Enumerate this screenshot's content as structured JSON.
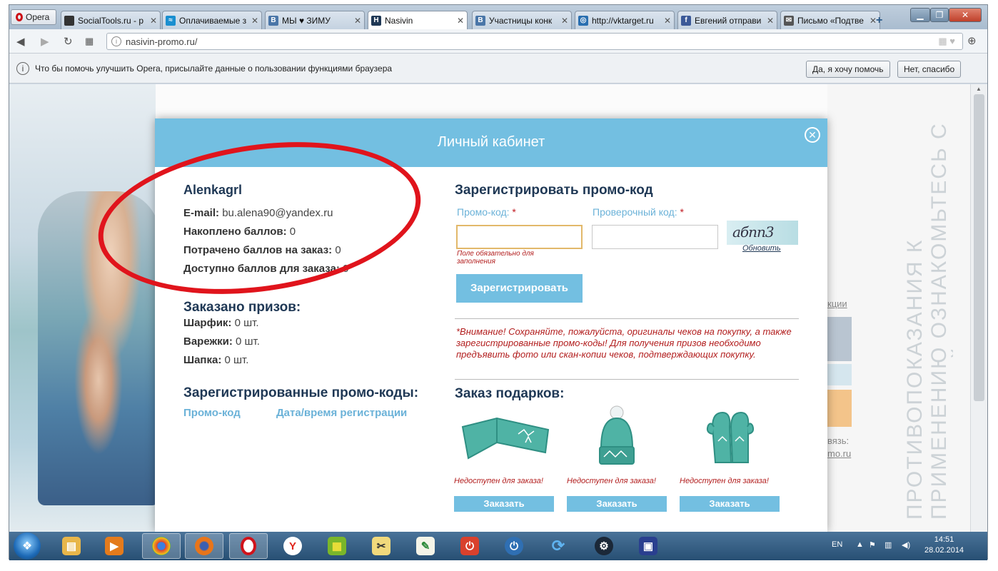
{
  "browser": {
    "menu_label": "Opera",
    "tabs": [
      {
        "title": "SocialTools.ru - р",
        "icon": "socialtools-icon",
        "color": "#333333",
        "glyph": ""
      },
      {
        "title": "Оплачиваемые з",
        "icon": "wave-icon",
        "color": "#1a8fd0",
        "glyph": "≈"
      },
      {
        "title": "МЫ ♥ ЗИМУ",
        "icon": "vk-icon",
        "color": "#4a76a8",
        "glyph": "B"
      },
      {
        "title": "Nasivin",
        "icon": "nasivin-icon",
        "color": "#1f3855",
        "glyph": "H"
      },
      {
        "title": "Участницы конк",
        "icon": "vk-icon",
        "color": "#4a76a8",
        "glyph": "B"
      },
      {
        "title": "http://vktarget.ru",
        "icon": "vktarget-icon",
        "color": "#2a6fb0",
        "glyph": "◎"
      },
      {
        "title": "Евгений отправи",
        "icon": "facebook-icon",
        "color": "#3b5998",
        "glyph": "f"
      },
      {
        "title": "Письмо «Подтве",
        "icon": "mail-icon",
        "color": "#555555",
        "glyph": "✉"
      }
    ],
    "url": "nasivin-promo.ru/",
    "infobar": {
      "message": "Что бы помочь улучшить Opera, присылайте данные о пользовании функциями браузера",
      "accept": "Да, я хочу помочь",
      "decline": "Нет, спасибо"
    }
  },
  "background": {
    "side_text": "ПРОТИВОПОКАЗАНИЯ К ПРИМЕНЕНИЮ ОЗНАКОМЬТЕСЬ С ИНСТРУКЦИЕЙ ПО ПРИМЕНЕНИЮ",
    "link_1": "кции",
    "link_2": "вязь:",
    "link_3": "mo.ru"
  },
  "modal": {
    "title": "Личный кабинет",
    "profile": {
      "username": "Alenkagrl",
      "email_label": "E-mail:",
      "email": "bu.alena90@yandex.ru",
      "earned_label": "Накоплено баллов:",
      "earned": "0",
      "spent_label": "Потрачено баллов на заказ:",
      "spent": "0",
      "available_label": "Доступно баллов для заказа:",
      "available": "0"
    },
    "ordered": {
      "heading": "Заказано призов:",
      "items": [
        {
          "label": "Шарфик:",
          "value": "0 шт."
        },
        {
          "label": "Варежки:",
          "value": "0 шт."
        },
        {
          "label": "Шапка:",
          "value": "0 шт."
        }
      ]
    },
    "registered_codes": {
      "heading": "Зарегистрированные промо-коды:",
      "col_code": "Промо-код",
      "col_date": "Дата/время регистрации"
    },
    "register": {
      "heading": "Зарегистрировать промо-код",
      "promo_label": "Промо-код:",
      "check_label": "Проверочный код:",
      "required_mark": "*",
      "promo_value": "",
      "check_value": "",
      "error": "Поле обязательно для заполнения",
      "captcha_text": "абпп3",
      "refresh": "Обновить",
      "button": "Зарегистрировать"
    },
    "warning": "*Внимание! Сохраняйте, пожалуйста, оригиналы чеков на покупку, а также зарегистрированные промо-коды! Для получения призов необходимо предъявить фото или скан-копии чеков, подтверждающих покупку.",
    "gifts": {
      "heading": "Заказ подарков:",
      "items": [
        {
          "name": "scarf",
          "status": "Недоступен для заказа!",
          "button": "Заказать"
        },
        {
          "name": "hat",
          "status": "Недоступен для заказа!",
          "button": "Заказать"
        },
        {
          "name": "mittens",
          "status": "Недоступен для заказа!",
          "button": "Заказать"
        }
      ]
    }
  },
  "taskbar": {
    "language": "EN",
    "time": "14:51",
    "date": "28.02.2014"
  },
  "colors": {
    "accent": "#73bfe1",
    "heading": "#1f3855",
    "error": "#b21d1d",
    "annotation": "#e0141c",
    "product": "#4fb3a5"
  }
}
